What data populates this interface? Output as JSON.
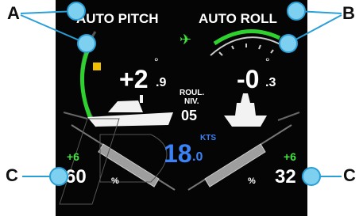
{
  "callouts": {
    "a": "A",
    "b": "B",
    "c_left": "C",
    "c_right": "C"
  },
  "pitch": {
    "title": "AUTO PITCH",
    "value": "+2",
    "decimal": ".9",
    "unit": "°"
  },
  "roll": {
    "title": "AUTO ROLL",
    "value": "-0",
    "decimal": ".3",
    "unit": "°"
  },
  "roll_level": {
    "label_line1": "ROUL.",
    "label_line2": "NIV.",
    "value": "05"
  },
  "speed": {
    "value": "18",
    "decimal": ".0",
    "unit": "KTS"
  },
  "left_tab": {
    "offset": "+6",
    "value": "60",
    "unit": "%"
  },
  "right_tab": {
    "offset": "+6",
    "value": "32",
    "unit": "%"
  },
  "icons": {
    "gps": "satellite-icon"
  },
  "colors": {
    "background": "#050505",
    "accent_green": "#2fd12f",
    "offset_green": "#3ee33e",
    "speed_blue": "#3b82f6",
    "callout_blue": "#2a9fd6"
  }
}
